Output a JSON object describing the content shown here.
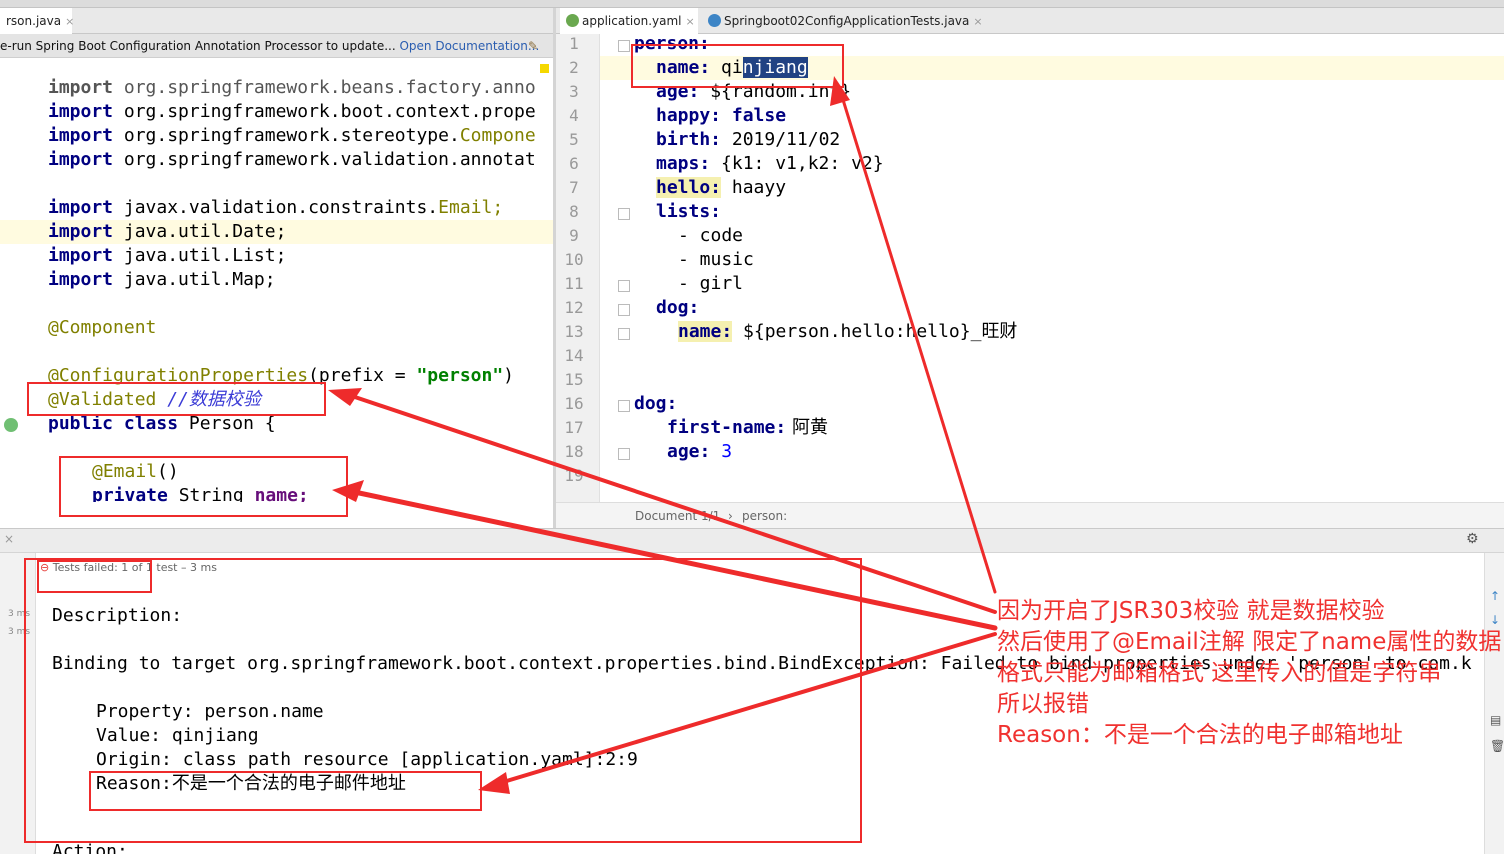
{
  "tabs_left": [
    {
      "label": "rson.java",
      "close": "×"
    }
  ],
  "tabs_right": [
    {
      "label": "application.yaml",
      "close": "×",
      "icon": "yaml-icon"
    },
    {
      "label": "Springboot02ConfigApplicationTests.java",
      "close": "×",
      "icon": "java-class-icon"
    }
  ],
  "notification": {
    "text": "e-run Spring Boot Configuration Annotation Processor to update... ",
    "link": "Open Documentation...",
    "icon": "wrench-icon"
  },
  "java_lines": [
    {
      "pre": "",
      "kw": "import",
      "rest": " org.springframework.beans.factory.anno"
    },
    {
      "pre": "",
      "kw": "import",
      "rest": " org.springframework.boot.context.prope"
    },
    {
      "pre": "",
      "kw": "import",
      "rest": " org.springframework.stereotype.",
      "tail": "Compone"
    },
    {
      "pre": "",
      "kw": "import",
      "rest": " org.springframework.validation.annotat"
    },
    {
      "pre": "",
      "kw": "import",
      "rest": " javax.validation.constraints.",
      "tail": "Email;"
    },
    {
      "pre": "",
      "kw": "import",
      "rest": " java.util.Date;"
    },
    {
      "pre": "",
      "kw": "import",
      "rest": " java.util.List;"
    },
    {
      "pre": "",
      "kw": "import",
      "rest": " java.util.Map;"
    }
  ],
  "java": {
    "component": "@Component",
    "config_props": "@ConfigurationProperties",
    "config_args_pre": "(prefix = ",
    "config_args_str": "\"person\"",
    "config_args_post": ")",
    "validated": "@Validated",
    "validated_comment": " //数据校验",
    "class_kw1": "public",
    "class_kw2": " class",
    "class_rest": " Person {",
    "email_ann": "@Email",
    "email_paren": "()",
    "field_kw": "private",
    "field_rest": " String ",
    "field_name": "name;"
  },
  "yaml_line_numbers": [
    "1",
    "2",
    "3",
    "4",
    "5",
    "6",
    "7",
    "8",
    "9",
    "10",
    "11",
    "12",
    "13",
    "14",
    "15",
    "16",
    "17",
    "18",
    "19"
  ],
  "yaml": {
    "l1": "person:",
    "l2_key": "name:",
    "l2_val_a": " qi",
    "l2_val_sel": "njiang",
    "l3_key": "age:",
    "l3_val": " ${random.int}",
    "l4_key": "happy:",
    "l4_val": " false",
    "l5_key": "birth:",
    "l5_val": " 2019/11/02",
    "l6_key": "maps:",
    "l6_val": " {k1: v1,k2: v2}",
    "l7_key": "hello:",
    "l7_val": " haayy",
    "l8_key": "lists:",
    "l9": "- code",
    "l10": "- music",
    "l11": "- girl",
    "l12_key": "dog:",
    "l13_key": "name:",
    "l13_val": " ${person.hello:hello}_",
    "l13_cn": "旺财",
    "l16_key": "dog:",
    "l17_key": "first-name:",
    "l17_val": " 阿黄",
    "l18_key": "age:",
    "l18_val": " 3"
  },
  "breadcrumb": {
    "doc": "Document 1/1",
    "sep": "›",
    "path": "person:"
  },
  "run": {
    "status_fail": "Tests failed: 1 of 1 test – 3 ms",
    "side_times": [
      "3 ms",
      "3 ms"
    ],
    "description": "Description:",
    "binding": "Binding to target org.springframework.boot.context.properties.bind.BindException: Failed to bind properties under 'person' to com.k",
    "property": "Property: person.name",
    "value": "Value: qinjiang",
    "origin": "Origin: class path resource [application.yaml]:2:9",
    "reason_label": "Reason:",
    "reason_text": "不是一个合法的电子邮件地址",
    "action": "Action:"
  },
  "annotation_note": [
    "因为开启了JSR303校验 就是数据校验",
    "然后使用了@Email注解 限定了name属性的数据",
    "格式只能为邮箱格式 这里传入的值是字符串",
    "所以报错",
    "Reason：不是一个合法的电子邮箱地址"
  ],
  "colors": {
    "annotation_red": "#ee2b2b",
    "keyword": "#000080",
    "selection": "#214283"
  }
}
